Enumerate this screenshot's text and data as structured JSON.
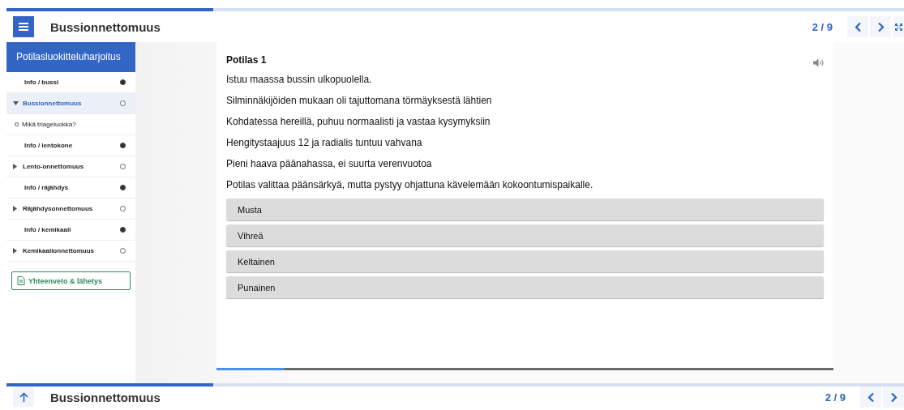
{
  "header": {
    "title": "Bussionnettomuus",
    "page": "2 / 9",
    "progress": {
      "level": 0.23
    }
  },
  "sidebar": {
    "title": "Potilasluokitteluharjoitus",
    "items": [
      {
        "kind": "info",
        "label": "Info / bussi",
        "completed": true,
        "selected": false
      },
      {
        "kind": "section",
        "label": "Bussionnettomuus",
        "completed": false,
        "selected": true,
        "expanded": true,
        "children": [
          {
            "kind": "question",
            "label": "Mikä triageluokka?",
            "selected": false
          }
        ]
      },
      {
        "kind": "info",
        "label": "Info / lentokone",
        "completed": true,
        "selected": false
      },
      {
        "kind": "section",
        "label": "Lento-onnettomuus",
        "completed": false,
        "selected": false,
        "expanded": false
      },
      {
        "kind": "info",
        "label": "Info / räjähdys",
        "completed": true,
        "selected": false
      },
      {
        "kind": "section",
        "label": "Räjähdysonnettomuus",
        "completed": false,
        "selected": false,
        "expanded": false
      },
      {
        "kind": "info",
        "label": "Info / kemikaali",
        "completed": true,
        "selected": false
      },
      {
        "kind": "section",
        "label": "Kemikaalionnettomuus",
        "completed": false,
        "selected": false,
        "expanded": false
      }
    ],
    "summary_button": "Yhteenveto & lähetys"
  },
  "card": {
    "title": "Potilas 1",
    "lines": [
      "Istuu maassa bussin ulkopuolella.",
      "Silminnäkijöiden mukaan oli tajuttomana törmäyksestä lähtien",
      "Kohdatessa hereillä, puhuu normaalisti ja vastaa kysymyksiin",
      "Hengitystaajuus 12 ja radialis tuntuu vahvana",
      "Pieni haava päänahassa, ei suurta verenvuotoa",
      "Potilas valittaa päänsärkyä, mutta pystyy ohjattuna kävelemään kokoontumispaikalle."
    ],
    "options": [
      {
        "label": "Musta",
        "selected": false
      },
      {
        "label": "Vihreä",
        "selected": false
      },
      {
        "label": "Keltainen",
        "selected": false
      },
      {
        "label": "Punainen",
        "selected": false
      }
    ],
    "progress": {
      "level": 0.11
    }
  },
  "footer": {
    "title": "Bussionnettomuus",
    "page": "2 / 9",
    "progress": {
      "level": 0.23
    }
  }
}
